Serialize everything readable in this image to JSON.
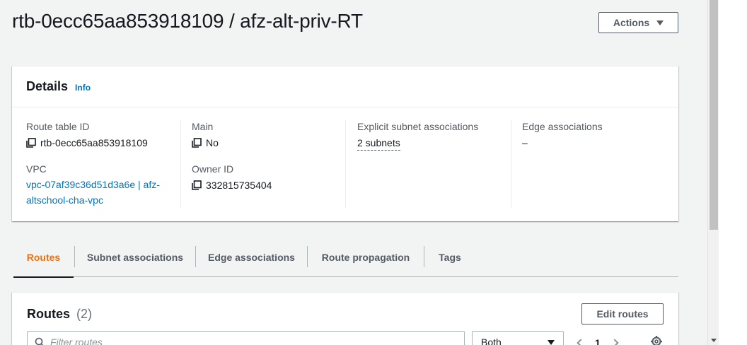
{
  "header": {
    "title": "rtb-0ecc65aa853918109 / afz-alt-priv-RT",
    "actions_label": "Actions"
  },
  "details": {
    "title": "Details",
    "info_label": "Info",
    "route_table_id_label": "Route table ID",
    "route_table_id_value": "rtb-0ecc65aa853918109",
    "vpc_label": "VPC",
    "vpc_value_line1": "vpc-07af39c36d51d3a6e | afz-",
    "vpc_value_line2": "altschool-cha-vpc",
    "main_label": "Main",
    "main_value": "No",
    "owner_id_label": "Owner ID",
    "owner_id_value": "332815735404",
    "explicit_subnet_label": "Explicit subnet associations",
    "explicit_subnet_value": "2 subnets",
    "edge_assoc_label": "Edge associations",
    "edge_assoc_value": "–"
  },
  "tabs": [
    {
      "label": "Routes",
      "active": true
    },
    {
      "label": "Subnet associations",
      "active": false
    },
    {
      "label": "Edge associations",
      "active": false
    },
    {
      "label": "Route propagation",
      "active": false
    },
    {
      "label": "Tags",
      "active": false
    }
  ],
  "routes": {
    "title": "Routes",
    "count": "(2)",
    "edit_label": "Edit routes",
    "filter_placeholder": "Filter routes",
    "select_value": "Both",
    "page_number": "1"
  },
  "colors": {
    "accent_orange": "#ec7211",
    "link_blue": "#0073bb",
    "text_dark": "#16191f",
    "background": "#f2f3f3"
  },
  "icons": {
    "copy": "copy-icon",
    "caret": "caret-down-icon",
    "search": "search-icon",
    "gear": "settings-icon"
  }
}
